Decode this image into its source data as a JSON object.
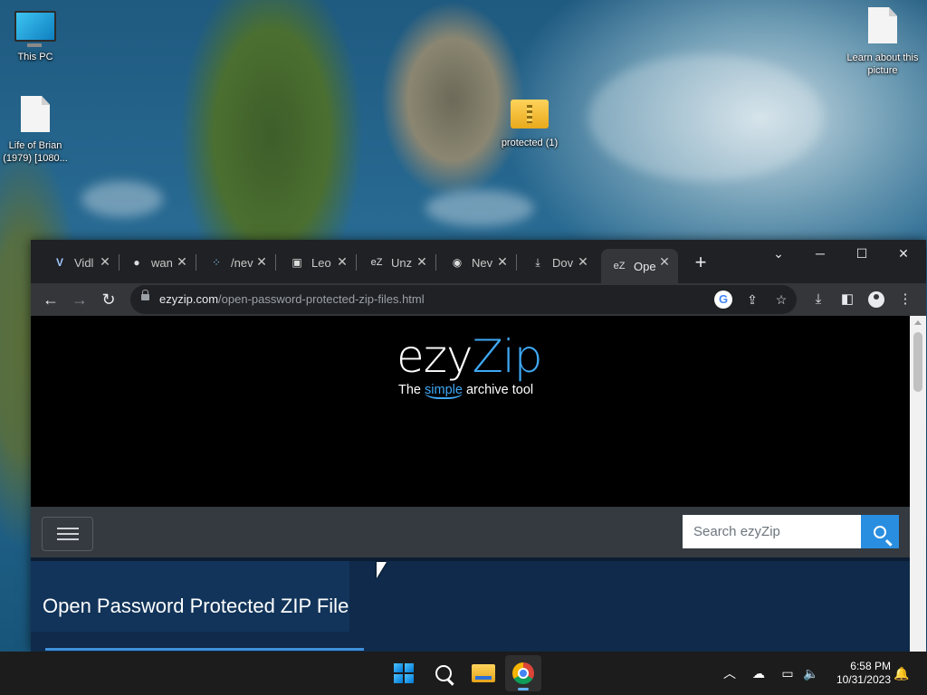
{
  "desktop": {
    "icons": [
      {
        "label": "This PC"
      },
      {
        "label": "Life of Brian (1979) [1080..."
      },
      {
        "label": "protected (1)"
      },
      {
        "label": "Learn about this picture"
      }
    ]
  },
  "browser": {
    "tabs": [
      {
        "label": "Vidl",
        "icon": "vl-icon"
      },
      {
        "label": "wan",
        "icon": "github-icon"
      },
      {
        "label": "/nev",
        "icon": "dotted-icon"
      },
      {
        "label": "Leo",
        "icon": "document-icon"
      },
      {
        "label": "Unz",
        "icon": "ezyzip-icon"
      },
      {
        "label": "Nev",
        "icon": "chrome-icon"
      },
      {
        "label": "Dov",
        "icon": "download-icon"
      },
      {
        "label": "Ope",
        "icon": "ezyzip-icon",
        "active": true
      }
    ],
    "url_domain": "ezyzip.com",
    "url_path": "/open-password-protected-zip-files.html"
  },
  "page": {
    "logo_ezy": "ezy",
    "logo_zip": "Zip",
    "tagline_pre": "The ",
    "tagline_hl": "simple",
    "tagline_post": " archive tool",
    "search_placeholder": "Search ezyZip",
    "title": "Open Password Protected ZIP File"
  },
  "taskbar": {
    "time": "6:58 PM",
    "date": "10/31/2023"
  },
  "colors": {
    "accent": "#3fa9f5",
    "navbar": "#343a40",
    "search_button": "#2a8ee0",
    "content_bg": "#0f2a4a"
  }
}
